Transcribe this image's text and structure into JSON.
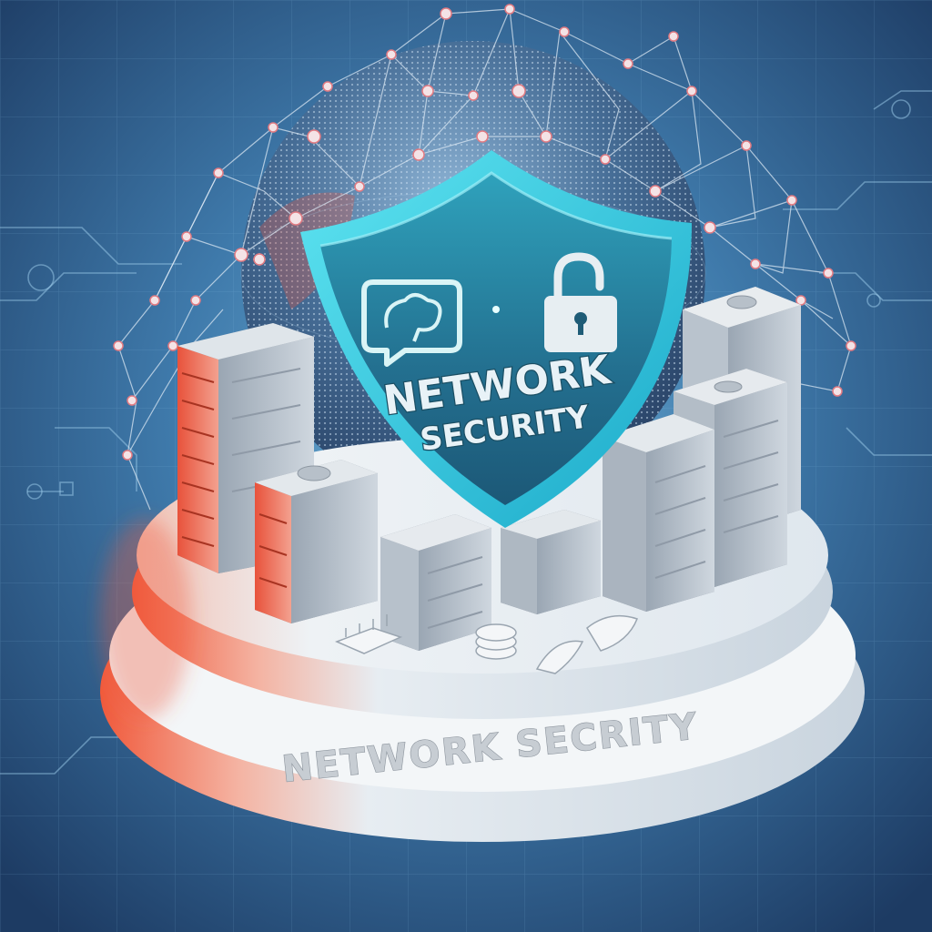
{
  "shield": {
    "line1": "NETWORK",
    "line2": "SECURITY",
    "icons": [
      "brain-chat-icon",
      "padlock-icon"
    ]
  },
  "base": {
    "label": "NETWORK SECRITY"
  },
  "colors": {
    "background": "#244a78",
    "shield_fill": "#2e8fa8",
    "shield_rim": "#49d5e8",
    "glow_red": "#f0553a",
    "platform": "#e6ecf1",
    "globe": "#3b5e86"
  }
}
